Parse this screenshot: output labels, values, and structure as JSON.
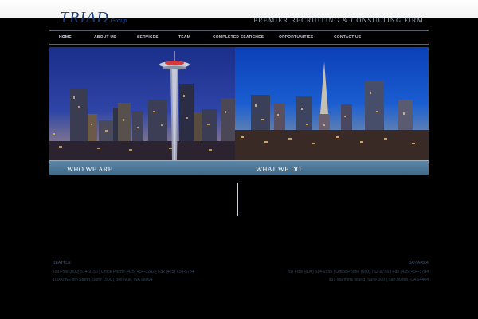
{
  "header": {
    "logo_main": "TRIAD",
    "logo_sub": "Group",
    "tagline": "PREMIER RECRUITING & CONSULTING FIRM"
  },
  "nav": {
    "items": [
      {
        "label": "HOME",
        "active": true
      },
      {
        "label": "ABOUT US",
        "active": false
      },
      {
        "label": "SERVICES",
        "active": false
      },
      {
        "label": "TEAM",
        "active": false
      },
      {
        "label": "COMPLETED SEARCHES",
        "active": false
      },
      {
        "label": "OPPORTUNITIES",
        "active": false
      },
      {
        "label": "CONTACT US",
        "active": false
      }
    ]
  },
  "tabs": {
    "left": "WHO WE ARE",
    "right": "WHAT WE DO"
  },
  "footer": {
    "left": {
      "city": "SEATTLE",
      "phones": "Toll Free (800) 514-9155 | Office Phone (425) 454-3282 | Fax (425) 454-5784",
      "address": "10900 NE 8th Street, Suite 1500 | Bellevue, WA 98004"
    },
    "right": {
      "city": "BAY AREA",
      "phones": "Toll Free (800) 514-9155 | Office Phone (650) 762-8756 | Fax (425) 454-5784",
      "address": "951 Mariners Island, Suite 300 | San Mateo, CA 94404"
    }
  },
  "colors": {
    "brand": "#1f3a78",
    "tab_bar": "#4f7898",
    "background": "#000000"
  },
  "hero": {
    "left_image": "seattle-skyline-night",
    "right_image": "san-francisco-skyline-night"
  }
}
